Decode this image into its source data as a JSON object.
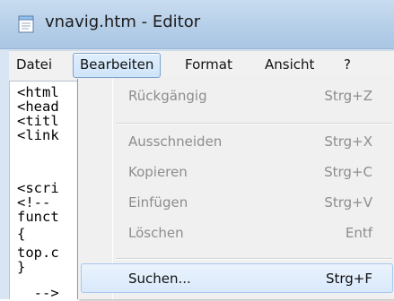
{
  "window": {
    "title": "vnavig.htm - Editor",
    "icon": "notepad-icon"
  },
  "menubar": {
    "items": [
      "Datei",
      "Bearbeiten",
      "Format",
      "Ansicht",
      "?"
    ],
    "active": "Bearbeiten"
  },
  "editor": {
    "lines": [
      "<html",
      "<head",
      "<titl",
      "<link",
      "",
      "<scri",
      "<!--",
      "funct",
      "{",
      "top.c",
      "}",
      "  -->"
    ]
  },
  "dropdown": {
    "items": [
      {
        "label": "Rückgängig",
        "shortcut": "Strg+Z",
        "enabled": false
      },
      {
        "label": "Ausschneiden",
        "shortcut": "Strg+X",
        "enabled": false
      },
      {
        "label": "Kopieren",
        "shortcut": "Strg+C",
        "enabled": false
      },
      {
        "label": "Einfügen",
        "shortcut": "Strg+V",
        "enabled": false
      },
      {
        "label": "Löschen",
        "shortcut": "Entf",
        "enabled": false
      },
      {
        "label": "Suchen...",
        "shortcut": "Strg+F",
        "enabled": true,
        "highlighted": true
      }
    ]
  },
  "colors": {
    "titlebar": "#b9d1ea",
    "menubar": "#f1f1f1",
    "highlight_border": "#a8c8ee",
    "disabled_text": "#8d8d8d"
  }
}
